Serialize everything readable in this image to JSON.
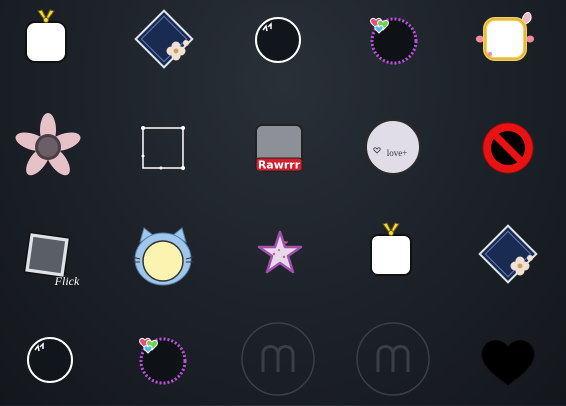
{
  "frames": {
    "rawrrr_label": "Rawrrr",
    "love_label": "love+",
    "flick_label": "Flick"
  },
  "colors": {
    "background": "#1c2128",
    "white": "#ffffff",
    "navy": "#1a2b52",
    "purple_ring": "#c04de0",
    "yellow_frame": "#f2d15a",
    "pink_flower": "#e6c2c8",
    "red_sign": "#e81212",
    "gray_square": "#8d9096",
    "lavender": "#e0dde6",
    "cat_blue": "#9fc6ec",
    "cat_face": "#fdf3b0"
  },
  "icons": [
    "bow-square-frame",
    "diamond-flower-frame",
    "dark-circle-frame",
    "heart-dotted-ring-frame",
    "yellow-bunny-frame",
    "pink-flower-frame",
    "sparkle-square-frame",
    "rawrrr-tag-frame",
    "love-circle-frame",
    "prohibited-sign-frame",
    "flick-tilted-photo-frame",
    "blue-cat-frame",
    "pink-star-frame",
    "bow-square-frame",
    "diamond-flower-frame",
    "dark-circle-frame",
    "heart-dotted-ring-frame",
    "locked-m-frame",
    "locked-m-frame",
    "black-heart-frame"
  ]
}
